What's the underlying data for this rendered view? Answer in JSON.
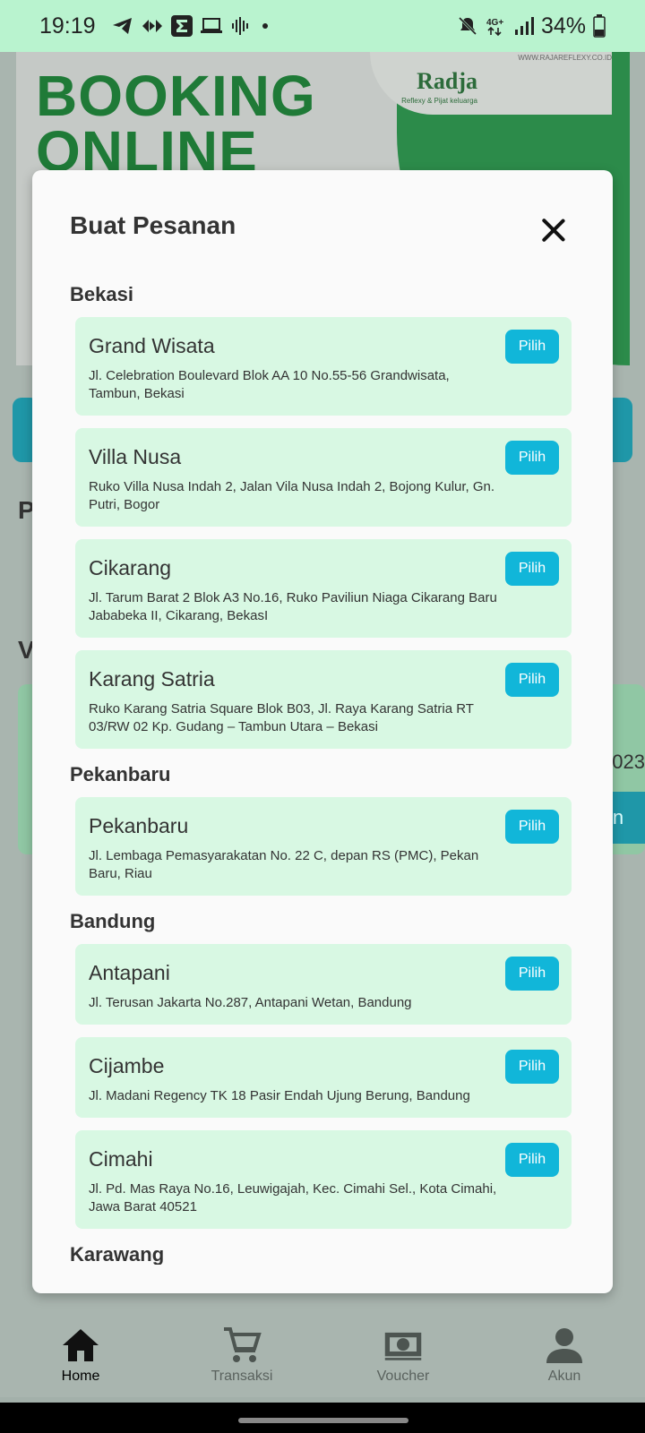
{
  "status_bar": {
    "time": "19:19",
    "left_icons": [
      "telegram-icon",
      "diamond-arrows-icon",
      "sigma-icon",
      "laptop-icon",
      "voice-wave-icon",
      "dot-icon"
    ],
    "right_icons": [
      "mute-icon",
      "4g-icon",
      "signal-icon"
    ],
    "battery": "34%"
  },
  "banner": {
    "title_line1": "BOOKING",
    "title_line2": "ONLINE",
    "logo": "Radja",
    "logo_sub": "Reflexy & Pijat keluarga",
    "url": "WWW.RAJAREFLEXY.CO.ID"
  },
  "background": {
    "letter_p": "P",
    "letter_v": "V",
    "card_text": "023",
    "card_button": "n"
  },
  "modal": {
    "title": "Buat Pesanan",
    "select_label": "Pilih",
    "regions": [
      {
        "name": "Bekasi",
        "branches": [
          {
            "name": "Grand Wisata",
            "address": "Jl. Celebration Boulevard Blok AA 10 No.55-56 Grandwisata, Tambun, Bekasi"
          },
          {
            "name": "Villa Nusa",
            "address": "Ruko Villa Nusa Indah 2, Jalan Vila Nusa Indah 2, Bojong Kulur, Gn. Putri, Bogor"
          },
          {
            "name": "Cikarang",
            "address": "Jl. Tarum Barat 2 Blok A3 No.16, Ruko Paviliun Niaga Cikarang Baru Jababeka II, Cikarang, BekasI"
          },
          {
            "name": "Karang Satria",
            "address": "Ruko Karang Satria Square Blok B03, Jl. Raya Karang Satria RT 03/RW 02 Kp. Gudang – Tambun Utara – Bekasi"
          }
        ]
      },
      {
        "name": "Pekanbaru",
        "branches": [
          {
            "name": "Pekanbaru",
            "address": "Jl. Lembaga Pemasyarakatan No. 22 C, depan RS (PMC), Pekan Baru, Riau"
          }
        ]
      },
      {
        "name": "Bandung",
        "branches": [
          {
            "name": "Antapani",
            "address": "Jl. Terusan Jakarta No.287, Antapani Wetan, Bandung"
          },
          {
            "name": "Cijambe",
            "address": "Jl. Madani Regency TK 18 Pasir Endah Ujung Berung, Bandung"
          },
          {
            "name": "Cimahi",
            "address": "Jl. Pd. Mas Raya No.16, Leuwigajah, Kec. Cimahi Sel., Kota Cimahi, Jawa Barat 40521"
          }
        ]
      },
      {
        "name": "Karawang",
        "branches": []
      }
    ]
  },
  "bottom_nav": [
    {
      "label": "Home",
      "icon": "home-icon",
      "active": true
    },
    {
      "label": "Transaksi",
      "icon": "cart-icon",
      "active": false
    },
    {
      "label": "Voucher",
      "icon": "money-icon",
      "active": false
    },
    {
      "label": "Akun",
      "icon": "person-icon",
      "active": false
    }
  ],
  "colors": {
    "status_bar": "#b9f3cf",
    "card_bg": "#d8f8e3",
    "pilih_button": "#11b6d9",
    "brand_green": "#1f7a37"
  }
}
